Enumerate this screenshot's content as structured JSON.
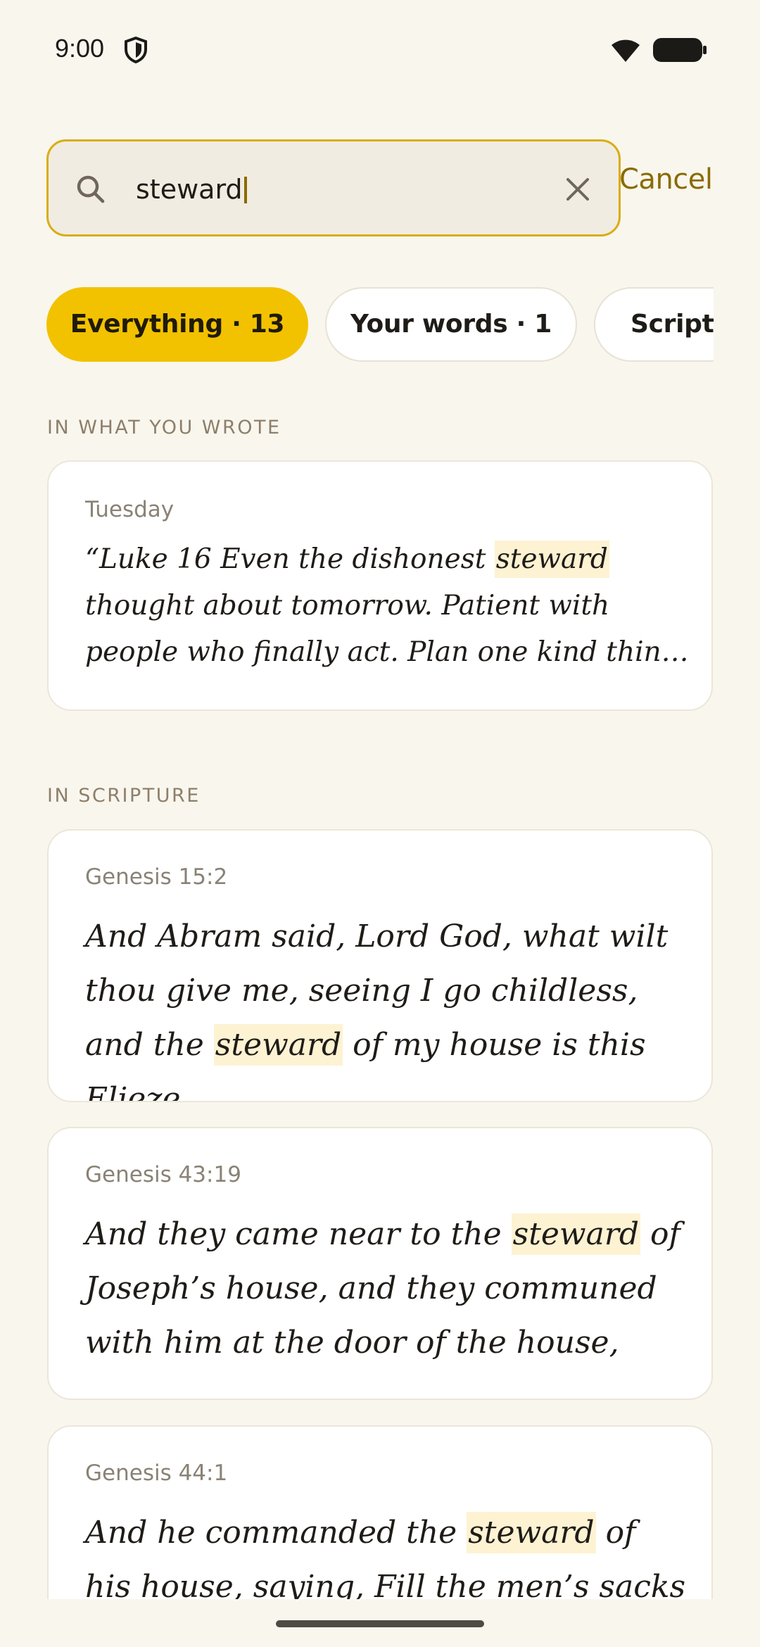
{
  "status_bar": {
    "time": "9:00"
  },
  "search": {
    "value": "steward",
    "cancel_label": "Cancel"
  },
  "filters": [
    {
      "label": "Everything · 13",
      "active": true
    },
    {
      "label": "Your words · 1",
      "active": false
    },
    {
      "label": "Scripture",
      "active": false
    }
  ],
  "sections": {
    "notes_label": "IN WHAT YOU WROTE",
    "scripture_label": "IN SCRIPTURE"
  },
  "note_results": [
    {
      "meta": "Tuesday",
      "before": "“Luke 16 Even the dishonest ",
      "match": "steward",
      "after": " thought about tomorrow. Patient with people who finally act. Plan one kind thin…"
    }
  ],
  "scripture_results": [
    {
      "meta": "Genesis 15:2",
      "before": "And Abram said, Lord God, what wilt thou give me, seeing I go childless, and the ",
      "match": "steward",
      "after": " of my house is this Elieze…"
    },
    {
      "meta": "Genesis 43:19",
      "before": "And they came near to the ",
      "match": "steward",
      "after": " of Joseph’s house, and they communed with him at the door of the house,"
    },
    {
      "meta": "Genesis 44:1",
      "before": "And he commanded the ",
      "match": "steward",
      "after": " of his house, saying, Fill the men’s sacks with"
    }
  ],
  "colors": {
    "accent": "#f2c200",
    "accent_text": "#8a6b00",
    "highlight": "#fdf2d2",
    "background": "#f9f6ee"
  }
}
